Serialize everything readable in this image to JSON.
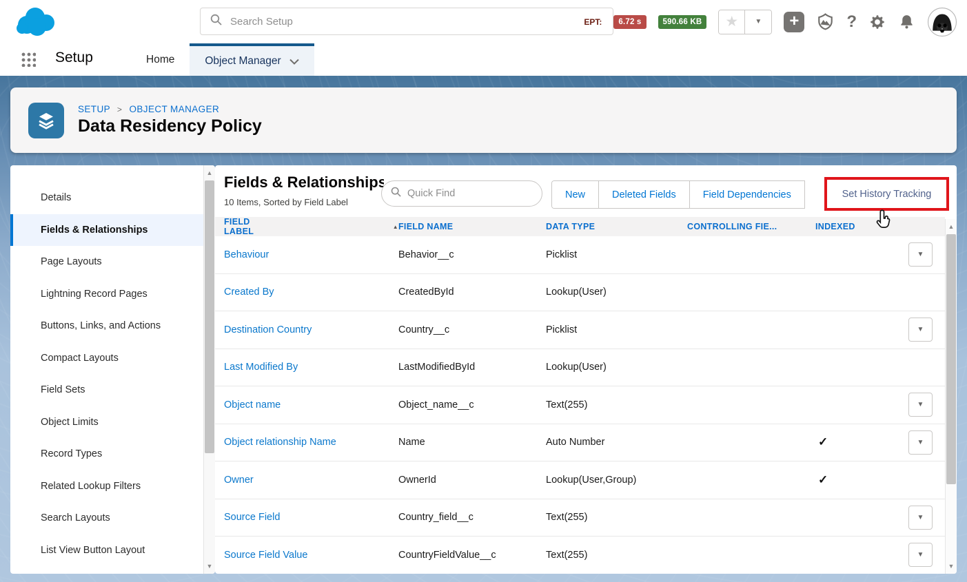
{
  "header": {
    "search_placeholder": "Search Setup",
    "ept_label": "EPT:",
    "ept_time": "6.72 s",
    "ept_size": "590.66 KB"
  },
  "nav": {
    "app_label": "Setup",
    "tabs": [
      {
        "label": "Home",
        "active": false
      },
      {
        "label": "Object Manager",
        "active": true
      }
    ]
  },
  "breadcrumb": {
    "parent": "SETUP",
    "separator": ">",
    "section": "OBJECT MANAGER",
    "title": "Data Residency Policy"
  },
  "sidebar": {
    "active_index": 1,
    "items": [
      {
        "label": "Details"
      },
      {
        "label": "Fields & Relationships"
      },
      {
        "label": "Page Layouts"
      },
      {
        "label": "Lightning Record Pages"
      },
      {
        "label": "Buttons, Links, and Actions"
      },
      {
        "label": "Compact Layouts"
      },
      {
        "label": "Field Sets"
      },
      {
        "label": "Object Limits"
      },
      {
        "label": "Record Types"
      },
      {
        "label": "Related Lookup Filters"
      },
      {
        "label": "Search Layouts"
      },
      {
        "label": "List View Button Layout"
      }
    ]
  },
  "main": {
    "title": "Fields & Relationships",
    "subtitle": "10 Items, Sorted by Field Label",
    "quick_find_placeholder": "Quick Find",
    "buttons": {
      "new": "New",
      "deleted_fields": "Deleted Fields",
      "field_dependencies": "Field Dependencies",
      "set_history_tracking": "Set History Tracking"
    },
    "columns": [
      "FIELD LABEL",
      "FIELD NAME",
      "DATA TYPE",
      "CONTROLLING FIE...",
      "INDEXED"
    ],
    "rows": [
      {
        "label": "Behaviour",
        "name": "Behavior__c",
        "type": "Picklist",
        "controlling": "",
        "indexed": false,
        "menu": true
      },
      {
        "label": "Created By",
        "name": "CreatedById",
        "type": "Lookup(User)",
        "controlling": "",
        "indexed": false,
        "menu": false
      },
      {
        "label": "Destination Country",
        "name": "Country__c",
        "type": "Picklist",
        "controlling": "",
        "indexed": false,
        "menu": true
      },
      {
        "label": "Last Modified By",
        "name": "LastModifiedById",
        "type": "Lookup(User)",
        "controlling": "",
        "indexed": false,
        "menu": false
      },
      {
        "label": "Object name",
        "name": "Object_name__c",
        "type": "Text(255)",
        "controlling": "",
        "indexed": false,
        "menu": true
      },
      {
        "label": "Object relationship Name",
        "name": "Name",
        "type": "Auto Number",
        "controlling": "",
        "indexed": true,
        "menu": true
      },
      {
        "label": "Owner",
        "name": "OwnerId",
        "type": "Lookup(User,Group)",
        "controlling": "",
        "indexed": true,
        "menu": false
      },
      {
        "label": "Source Field",
        "name": "Country_field__c",
        "type": "Text(255)",
        "controlling": "",
        "indexed": false,
        "menu": true
      },
      {
        "label": "Source Field Value",
        "name": "CountryFieldValue__c",
        "type": "Text(255)",
        "controlling": "",
        "indexed": false,
        "menu": true
      }
    ]
  },
  "annotation": {
    "type": "highlight-box",
    "color": "#e0151b",
    "target": "Set History Tracking"
  },
  "colors": {
    "accent_blue": "#0176d3",
    "tab_top_border": "#15598c",
    "object_tile": "#2d78a7",
    "ept_red": "#b94b47",
    "ept_green": "#43813c"
  }
}
